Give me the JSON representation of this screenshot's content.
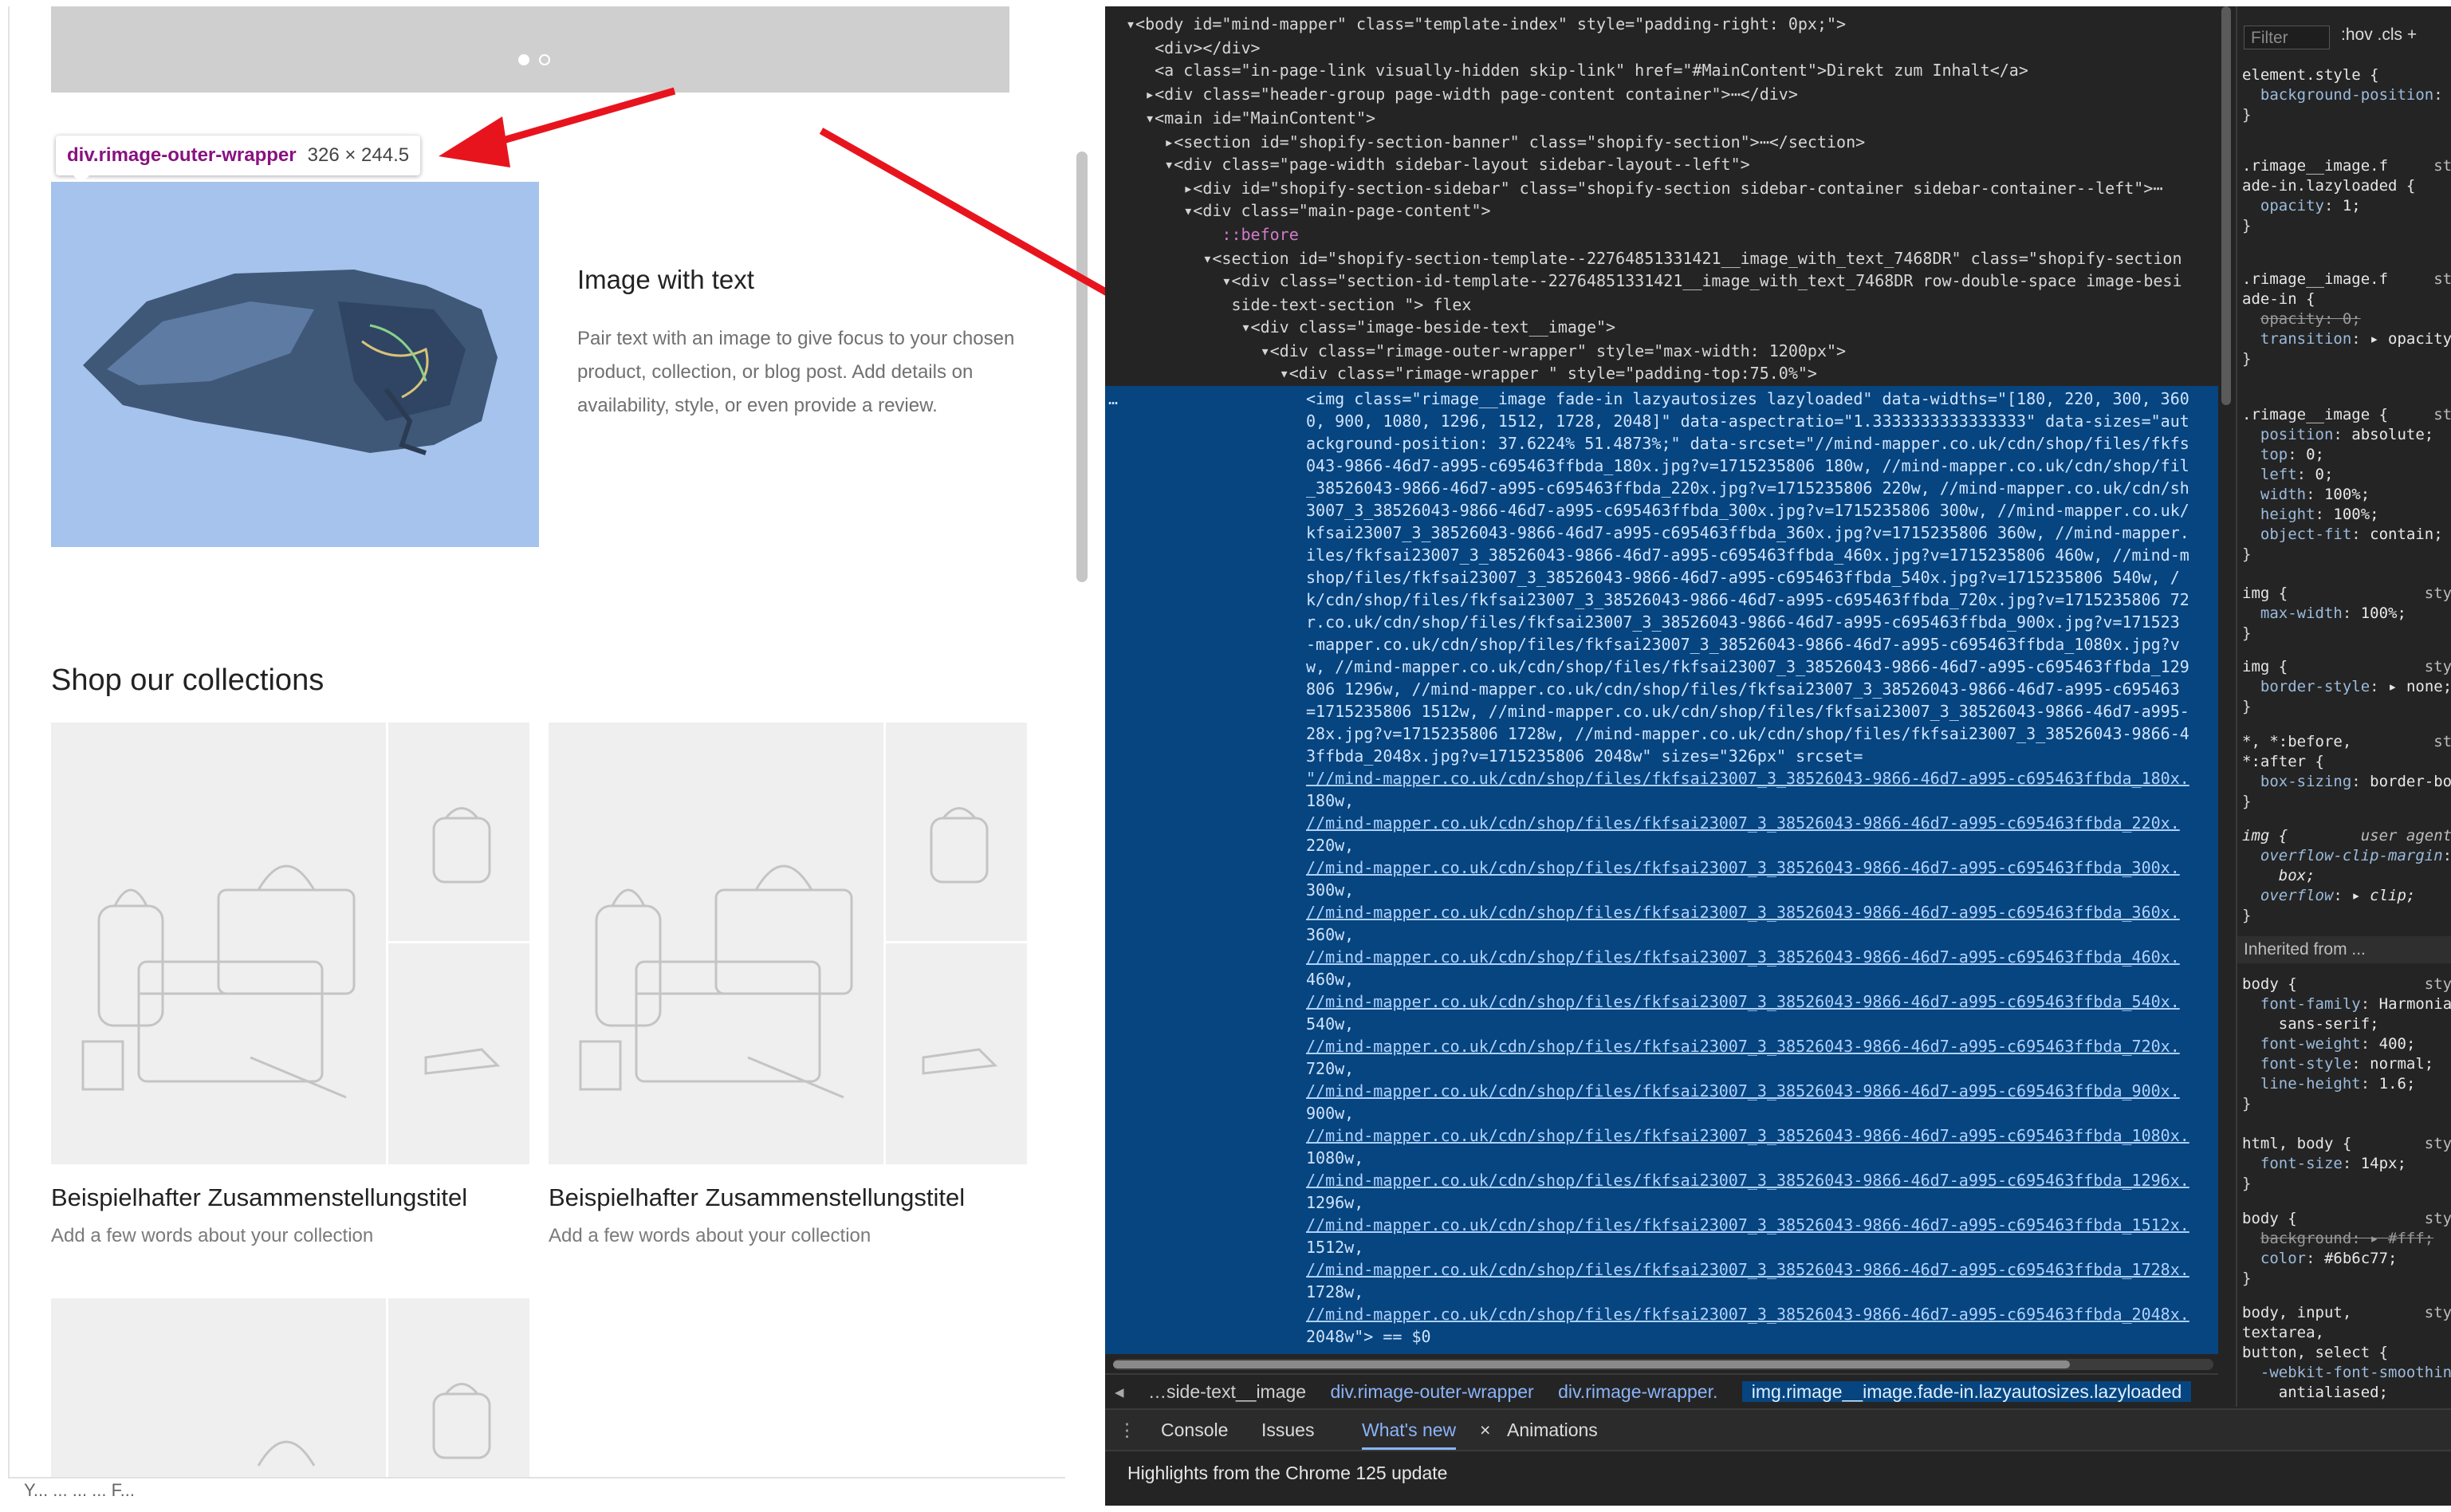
{
  "page": {
    "tooltip_selector": "div.rimage-outer-wrapper",
    "tooltip_size": "326 × 244.5",
    "image_with_text_title": "Image with text",
    "image_with_text_body": "Pair text with an image to give focus to your chosen product, collection, or blog post. Add details on availability, style, or even provide a review.",
    "collections_heading": "Shop our collections",
    "collections": [
      {
        "title": "Beispielhafter Zusammenstellungstitel",
        "desc": "Add a few words about your collection"
      },
      {
        "title": "Beispielhafter Zusammenstellungstitel",
        "desc": "Add a few words about your collection"
      }
    ],
    "footer_text": "Y... ... ... ... F..."
  },
  "devtools": {
    "tree": [
      "▾<body id=\"mind-mapper\" class=\"template-index\" style=\"padding-right: 0px;\">",
      "   <div></div>",
      "   <a class=\"in-page-link visually-hidden skip-link\" href=\"#MainContent\">Direkt zum Inhalt</a>",
      "  ▸<div class=\"header-group page-width page-content container\">⋯</div>",
      "  ▾<main id=\"MainContent\">",
      "    ▸<section id=\"shopify-section-banner\" class=\"shopify-section\">⋯</section>",
      "    ▾<div class=\"page-width sidebar-layout sidebar-layout--left\">",
      "      ▸<div id=\"shopify-section-sidebar\" class=\"shopify-section sidebar-container sidebar-container--left\">⋯",
      "      ▾<div class=\"main-page-content\">",
      "          ::before",
      "        ▾<section id=\"shopify-section-template--22764851331421__image_with_text_7468DR\" class=\"shopify-section",
      "          ▾<div class=\"section-id-template--22764851331421__image_with_text_7468DR row-double-space image-besi",
      "           side-text-section \"> flex",
      "            ▾<div class=\"image-beside-text__image\">",
      "              ▾<div class=\"rimage-outer-wrapper\" style=\"max-width: 1200px\">",
      "                ▾<div class=\"rimage-wrapper \" style=\"padding-top:75.0%\">"
    ],
    "selected_lines": [
      "<img class=\"rimage__image fade-in lazyautosizes lazyloaded\" data-widths=\"[180, 220, 300, 360",
      "0, 900, 1080, 1296, 1512, 1728, 2048]\" data-aspectratio=\"1.3333333333333333\" data-sizes=\"aut",
      "ackground-position: 37.6224% 51.4873%;\" data-srcset=\"//mind-mapper.co.uk/cdn/shop/files/fkfs",
      "043-9866-46d7-a995-c695463ffbda_180x.jpg?v=1715235806 180w, //mind-mapper.co.uk/cdn/shop/fil",
      "_38526043-9866-46d7-a995-c695463ffbda_220x.jpg?v=1715235806 220w, //mind-mapper.co.uk/cdn/sh",
      "3007_3_38526043-9866-46d7-a995-c695463ffbda_300x.jpg?v=1715235806 300w, //mind-mapper.co.uk/",
      "kfsai23007_3_38526043-9866-46d7-a995-c695463ffbda_360x.jpg?v=1715235806 360w, //mind-mapper.",
      "iles/fkfsai23007_3_38526043-9866-46d7-a995-c695463ffbda_460x.jpg?v=1715235806 460w, //mind-m",
      "shop/files/fkfsai23007_3_38526043-9866-46d7-a995-c695463ffbda_540x.jpg?v=1715235806 540w, /",
      "k/cdn/shop/files/fkfsai23007_3_38526043-9866-46d7-a995-c695463ffbda_720x.jpg?v=1715235806 72",
      "r.co.uk/cdn/shop/files/fkfsai23007_3_38526043-9866-46d7-a995-c695463ffbda_900x.jpg?v=171523",
      "-mapper.co.uk/cdn/shop/files/fkfsai23007_3_38526043-9866-46d7-a995-c695463ffbda_1080x.jpg?v",
      "w, //mind-mapper.co.uk/cdn/shop/files/fkfsai23007_3_38526043-9866-46d7-a995-c695463ffbda_129",
      "806 1296w, //mind-mapper.co.uk/cdn/shop/files/fkfsai23007_3_38526043-9866-46d7-a995-c695463",
      "=1715235806 1512w, //mind-mapper.co.uk/cdn/shop/files/fkfsai23007_3_38526043-9866-46d7-a995-",
      "28x.jpg?v=1715235806 1728w, //mind-mapper.co.uk/cdn/shop/files/fkfsai23007_3_38526043-9866-4",
      "3ffbda_2048x.jpg?v=1715235806 2048w\" sizes=\"326px\" srcset="
    ],
    "srcset_lines": [
      {
        "url": "\"//mind-mapper.co.uk/cdn/shop/files/fkfsai23007_3_38526043-9866-46d7-a995-c695463ffbda_180x.",
        "w": "180w,"
      },
      {
        "url": "//mind-mapper.co.uk/cdn/shop/files/fkfsai23007_3_38526043-9866-46d7-a995-c695463ffbda_220x.",
        "w": "220w,"
      },
      {
        "url": "//mind-mapper.co.uk/cdn/shop/files/fkfsai23007_3_38526043-9866-46d7-a995-c695463ffbda_300x.",
        "w": "300w,"
      },
      {
        "url": "//mind-mapper.co.uk/cdn/shop/files/fkfsai23007_3_38526043-9866-46d7-a995-c695463ffbda_360x.",
        "w": "360w,"
      },
      {
        "url": "//mind-mapper.co.uk/cdn/shop/files/fkfsai23007_3_38526043-9866-46d7-a995-c695463ffbda_460x.",
        "w": "460w,"
      },
      {
        "url": "//mind-mapper.co.uk/cdn/shop/files/fkfsai23007_3_38526043-9866-46d7-a995-c695463ffbda_540x.",
        "w": "540w,"
      },
      {
        "url": "//mind-mapper.co.uk/cdn/shop/files/fkfsai23007_3_38526043-9866-46d7-a995-c695463ffbda_720x.",
        "w": "720w,"
      },
      {
        "url": "//mind-mapper.co.uk/cdn/shop/files/fkfsai23007_3_38526043-9866-46d7-a995-c695463ffbda_900x.",
        "w": "900w,"
      },
      {
        "url": "//mind-mapper.co.uk/cdn/shop/files/fkfsai23007_3_38526043-9866-46d7-a995-c695463ffbda_1080x.",
        "w": "1080w,"
      },
      {
        "url": "//mind-mapper.co.uk/cdn/shop/files/fkfsai23007_3_38526043-9866-46d7-a995-c695463ffbda_1296x.",
        "w": "1296w,"
      },
      {
        "url": "//mind-mapper.co.uk/cdn/shop/files/fkfsai23007_3_38526043-9866-46d7-a995-c695463ffbda_1512x.",
        "w": "1512w,"
      },
      {
        "url": "//mind-mapper.co.uk/cdn/shop/files/fkfsai23007_3_38526043-9866-46d7-a995-c695463ffbda_1728x.",
        "w": "1728w,"
      },
      {
        "url": "//mind-mapper.co.uk/cdn/shop/files/fkfsai23007_3_38526043-9866-46d7-a995-c695463ffbda_2048x.",
        "w": "2048w\"> == $0"
      }
    ],
    "breadcrumbs": [
      "…side-text__image",
      "div.rimage-outer-wrapper",
      "div.rimage-wrapper.",
      "img.rimage__image.fade-in.lazyautosizes.lazyloaded"
    ],
    "drawer_tabs": [
      "Console",
      "Issues",
      "What's new",
      "Animations"
    ],
    "drawer_text": "Highlights from the Chrome 125 update",
    "styles_filter_placeholder": "Filter",
    "styles_toolbar": ":hov  .cls  +",
    "inherited_label": "Inherited from ..."
  },
  "colors": {
    "accent": "#8ab4f8",
    "selection": "#06457f",
    "arrow": "#e8141d"
  }
}
